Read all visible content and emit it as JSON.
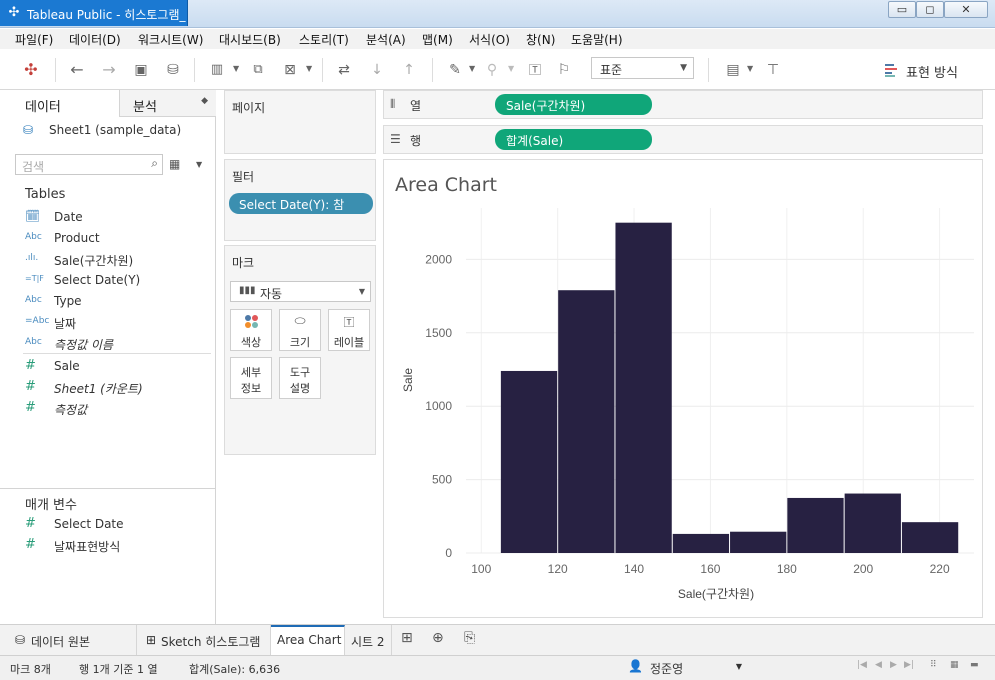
{
  "window": {
    "title": "Tableau Public - 히스토그램_",
    "min_label": "▭",
    "max_label": "◻",
    "close_label": "✕"
  },
  "menu": {
    "items": [
      "파일(F)",
      "데이터(D)",
      "워크시트(W)",
      "대시보드(B)",
      "스토리(T)",
      "분석(A)",
      "맵(M)",
      "서식(O)",
      "창(N)",
      "도움말(H)"
    ]
  },
  "toolbar": {
    "fit_select": "표준",
    "show_me_label": "표현 방식",
    "icons": [
      "tableau-logo-icon",
      "undo-icon",
      "redo-icon",
      "save-icon",
      "new-datasource-icon",
      "new-worksheet-icon",
      "duplicate-icon",
      "clear-sheet-icon",
      "swap-icon",
      "sort-ascending-icon",
      "sort-descending-icon",
      "highlight-icon",
      "group-icon",
      "label-icon",
      "pin-icon",
      "show-cards-icon",
      "presentation-icon"
    ]
  },
  "data_pane": {
    "tab_data": "데이터",
    "tab_analysis": "분석",
    "datasource": "Sheet1 (sample_data)",
    "search_placeholder": "검색",
    "tables_title": "Tables",
    "dimensions": [
      {
        "icon": "calendar-icon",
        "glyph": "",
        "label": "Date"
      },
      {
        "icon": "abc-icon",
        "glyph": "Abc",
        "label": "Product"
      },
      {
        "icon": "bin-icon",
        "glyph": ".ılı.",
        "label": "Sale(구간차원)"
      },
      {
        "icon": "boolean-icon",
        "glyph": "=T|F",
        "label": "Select Date(Y)"
      },
      {
        "icon": "abc-icon",
        "glyph": "Abc",
        "label": "Type"
      },
      {
        "icon": "calculated-abc-icon",
        "glyph": "=Abc",
        "label": "날짜"
      },
      {
        "icon": "abc-icon",
        "glyph": "Abc",
        "label": "측정값 이름"
      }
    ],
    "measures": [
      {
        "icon": "measure-icon",
        "glyph": "#",
        "label": "Sale"
      },
      {
        "icon": "measure-icon",
        "glyph": "#",
        "label": "Sheet1 (카운트)"
      },
      {
        "icon": "measure-icon",
        "glyph": "#",
        "label": "측정값"
      }
    ],
    "params_title": "매개 변수",
    "parameters": [
      {
        "icon": "measure-icon",
        "glyph": "#",
        "label": "Select Date"
      },
      {
        "icon": "measure-icon",
        "glyph": "#",
        "label": "날짜표현방식"
      }
    ]
  },
  "cards": {
    "pages_title": "페이지",
    "filters_title": "필터",
    "filter_pill": "Select Date(Y): 참",
    "marks_title": "마크",
    "mark_type": "자동",
    "mark_buttons": [
      {
        "name": "color",
        "label": "색상"
      },
      {
        "name": "size",
        "label": "크기"
      },
      {
        "name": "label",
        "label": "레이블"
      },
      {
        "name": "detail",
        "label1": "세부",
        "label2": "정보"
      },
      {
        "name": "tooltip",
        "label1": "도구",
        "label2": "설명"
      }
    ]
  },
  "shelves": {
    "columns_label": "열",
    "columns_pill": "Sale(구간차원)",
    "rows_label": "행",
    "rows_pill": "합계(Sale)"
  },
  "sheet": {
    "title": "Area Chart"
  },
  "chart_data": {
    "type": "bar",
    "bin_edges": [
      105,
      120,
      135,
      150,
      165,
      180,
      195,
      210,
      225
    ],
    "values": [
      1240,
      1790,
      2250,
      130,
      145,
      375,
      405,
      210
    ],
    "xlabel": "Sale(구간차원)",
    "ylabel": "Sale",
    "xticks": [
      100,
      120,
      140,
      160,
      180,
      200,
      220
    ],
    "yticks": [
      0,
      500,
      1000,
      1500,
      2000
    ],
    "xlim": [
      96,
      229
    ],
    "ylim": [
      0,
      2350
    ],
    "bar_color": "#272142",
    "grid": true
  },
  "sheet_tabs": [
    {
      "icon": "datasource-icon",
      "glyph": "⛁",
      "label": "데이터 원본"
    },
    {
      "icon": "worksheet-icon",
      "glyph": "⊞",
      "label": "Sketch 히스토그램"
    },
    {
      "icon": "",
      "glyph": "",
      "label": "Area Chart"
    },
    {
      "icon": "",
      "glyph": "",
      "label": "시트 2"
    }
  ],
  "status": {
    "marks": "마크 8개",
    "rows_cols": "행 1개 기준 1 열",
    "sum": "합계(Sale): 6,636",
    "user": "정준영"
  }
}
